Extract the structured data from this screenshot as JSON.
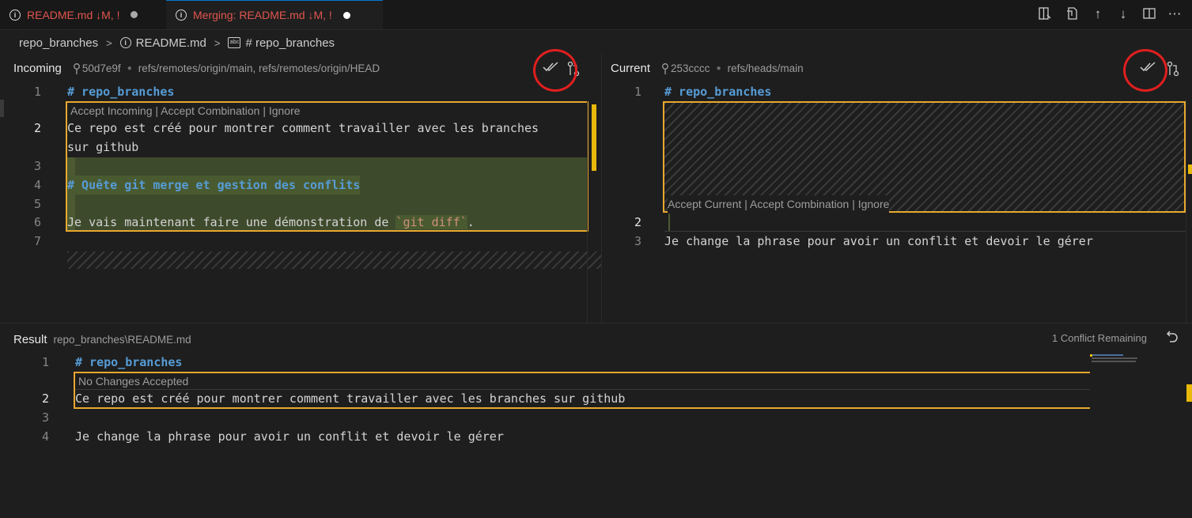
{
  "tabs": [
    {
      "label": "README.md",
      "status": "↓M, !"
    },
    {
      "label": "Merging: README.md",
      "status": "↓M, !"
    }
  ],
  "toolbar_icons": [
    "split-editor-icon",
    "open-file-icon",
    "arrow-up-icon",
    "arrow-down-icon",
    "layout-icon",
    "more-icon"
  ],
  "breadcrumb": {
    "folder": "repo_branches",
    "file": "README.md",
    "symbol": "# repo_branches"
  },
  "incoming": {
    "title": "Incoming",
    "commit": "50d7e9f",
    "refs": "refs/remotes/origin/main, refs/remotes/origin/HEAD",
    "codelens": "Accept Incoming | Accept Combination | Ignore",
    "lines": [
      {
        "n": "1",
        "text": "# repo_branches"
      },
      {
        "n": "2",
        "text": "Ce repo est créé pour montrer comment travailler avec les branches"
      },
      {
        "n": "",
        "text": "sur github"
      },
      {
        "n": "3",
        "text": ""
      },
      {
        "n": "4",
        "text": "# Quête git merge et gestion des conflits"
      },
      {
        "n": "5",
        "text": ""
      },
      {
        "n": "6",
        "text": "Je vais maintenant faire une démonstration de `git diff`."
      },
      {
        "n": "7",
        "text": ""
      }
    ],
    "line6": {
      "before": "Je vais maintenant faire une démonstration de ",
      "code": "`git diff`",
      "after": "."
    }
  },
  "current": {
    "title": "Current",
    "commit": "253cccc",
    "refs": "refs/heads/main",
    "codelens": "Accept Current | Accept Combination | Ignore",
    "lines": [
      {
        "n": "1",
        "text": "# repo_branches"
      },
      {
        "n": "2",
        "text": ""
      },
      {
        "n": "3",
        "text": "Je change la phrase pour avoir un conflit et devoir le gérer"
      }
    ]
  },
  "result": {
    "title": "Result",
    "path": "repo_branches\\README.md",
    "status": "1 Conflict Remaining",
    "codelens": "No Changes Accepted",
    "lines": [
      {
        "n": "1",
        "text": "# repo_branches"
      },
      {
        "n": "2",
        "text": "Ce repo est créé pour montrer comment travailler avec les branches sur github"
      },
      {
        "n": "3",
        "text": ""
      },
      {
        "n": "4",
        "text": "Je change la phrase pour avoir un conflit et devoir le gérer"
      }
    ]
  },
  "colors": {
    "conflict_border": "#e8a82e",
    "annotation_circle": "#e01f1f",
    "heading": "#569cd6",
    "added_bg": "#3e4a2c",
    "code_span": "#ce9178"
  }
}
